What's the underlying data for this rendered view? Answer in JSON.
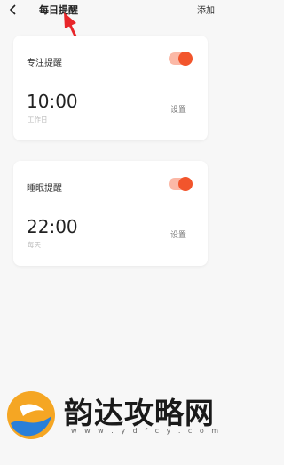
{
  "header": {
    "title": "每日提醒",
    "add_label": "添加"
  },
  "reminders": [
    {
      "label": "专注提醒",
      "time": "10:00",
      "repeat": "工作日",
      "enabled": true,
      "setting_label": "设置"
    },
    {
      "label": "睡眠提醒",
      "time": "22:00",
      "repeat": "每天",
      "enabled": true,
      "setting_label": "设置"
    }
  ],
  "colors": {
    "toggle_on": "#f2552c",
    "toggle_track": "#fbb8a6",
    "annotation_arrow": "#e8262a"
  },
  "watermark": {
    "title": "韵达攻略网",
    "url": "w w w . y d f c y . c o m"
  }
}
